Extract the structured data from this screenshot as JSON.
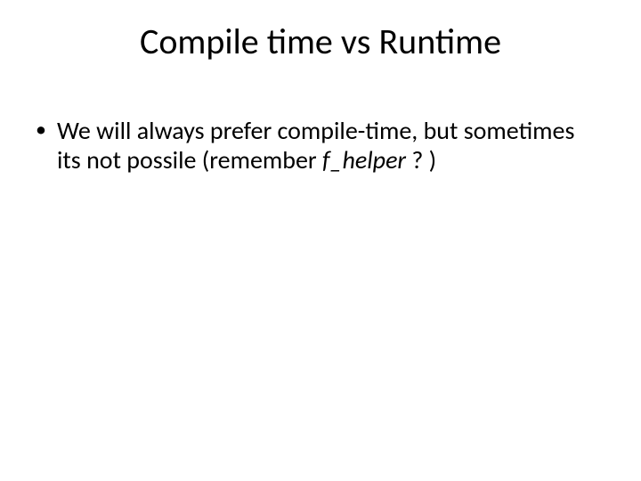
{
  "slide": {
    "title": "Compile time vs Runtime",
    "bullets": [
      {
        "segments": [
          {
            "text": "We will always prefer compile-time, but sometimes its not possile (remember ",
            "italic": false
          },
          {
            "text": "f_helper",
            "italic": true
          },
          {
            "text": " ? )",
            "italic": false
          }
        ]
      }
    ]
  }
}
